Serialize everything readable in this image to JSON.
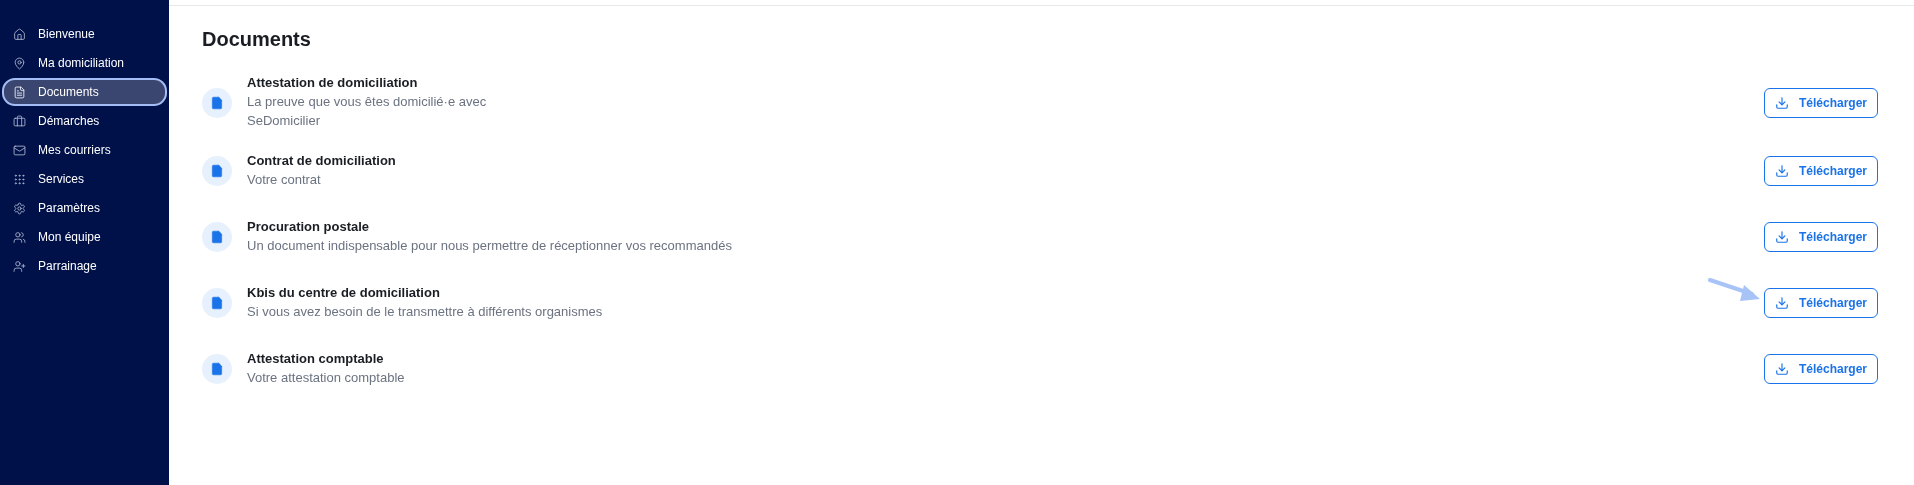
{
  "sidebar": {
    "items": [
      {
        "label": "Bienvenue",
        "selected": false
      },
      {
        "label": "Ma domiciliation",
        "selected": false
      },
      {
        "label": "Documents",
        "selected": true
      },
      {
        "label": "Démarches",
        "selected": false
      },
      {
        "label": "Mes courriers",
        "selected": false
      },
      {
        "label": "Services",
        "selected": false
      },
      {
        "label": "Paramètres",
        "selected": false
      },
      {
        "label": "Mon équipe",
        "selected": false
      },
      {
        "label": "Parrainage",
        "selected": false
      }
    ]
  },
  "page": {
    "title": "Documents"
  },
  "documents": [
    {
      "title": "Attestation de domiciliation",
      "description": "La preuve que vous êtes domicilié·e avec SeDomicilier",
      "button": "Télécharger",
      "pointed": false
    },
    {
      "title": "Contrat de domiciliation",
      "description": "Votre contrat",
      "button": "Télécharger",
      "pointed": false
    },
    {
      "title": "Procuration postale",
      "description": "Un document indispensable pour nous permettre de réceptionner vos recommandés",
      "button": "Télécharger",
      "pointed": false
    },
    {
      "title": "Kbis du centre de domiciliation",
      "description": "Si vous avez besoin de le transmettre à différents organismes",
      "button": "Télécharger",
      "pointed": true
    },
    {
      "title": "Attestation comptable",
      "description": "Votre attestation comptable",
      "button": "Télécharger",
      "pointed": false
    }
  ]
}
